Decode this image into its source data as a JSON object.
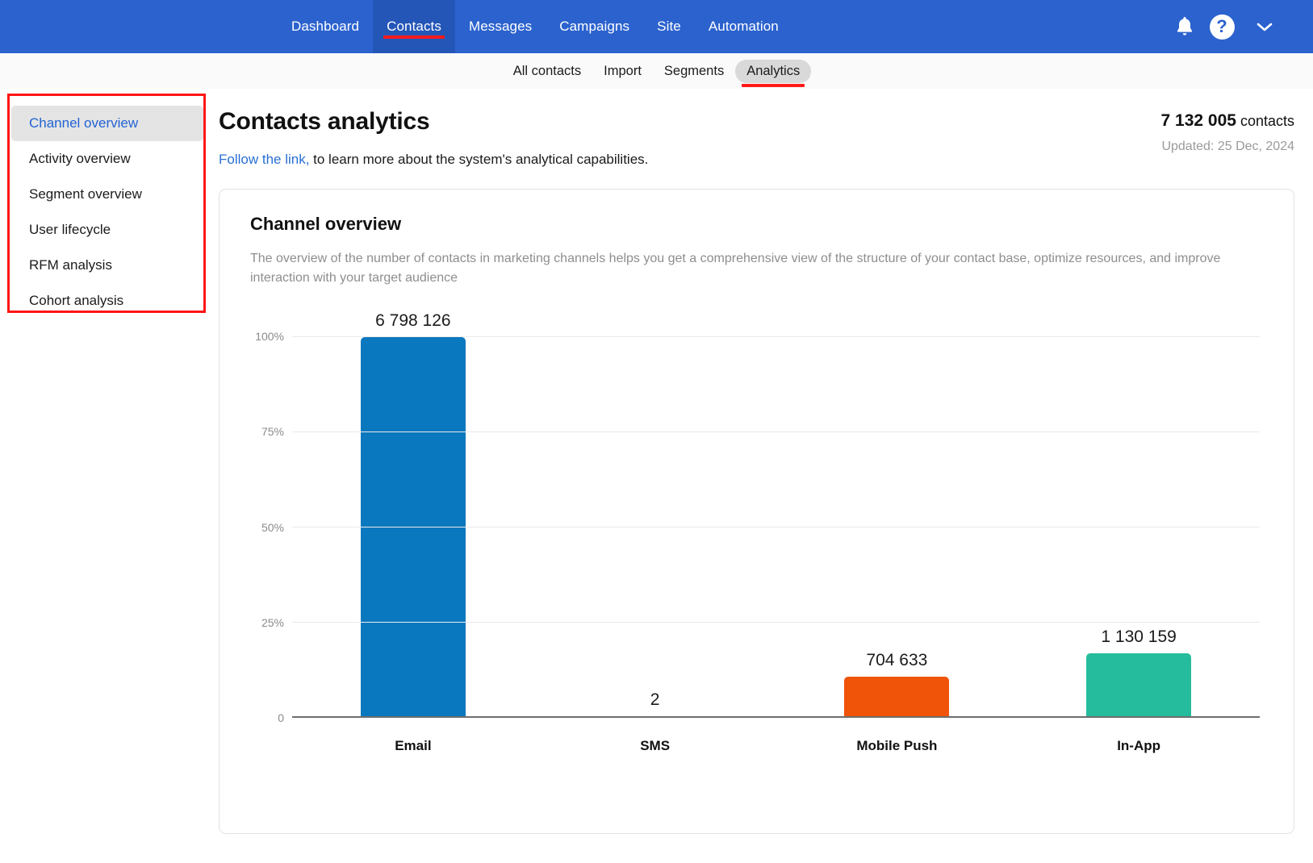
{
  "topnav": {
    "items": [
      {
        "label": "Dashboard",
        "active": false,
        "annotated": false
      },
      {
        "label": "Contacts",
        "active": true,
        "annotated": true
      },
      {
        "label": "Messages",
        "active": false,
        "annotated": false
      },
      {
        "label": "Campaigns",
        "active": false,
        "annotated": false
      },
      {
        "label": "Site",
        "active": false,
        "annotated": false
      },
      {
        "label": "Automation",
        "active": false,
        "annotated": false
      }
    ],
    "bell_icon": "bell-icon",
    "help_label": "?",
    "chevron_label": "⌄",
    "bg_color": "#2b62ce",
    "active_bg_color": "#2456b8"
  },
  "subnav": {
    "items": [
      {
        "label": "All contacts",
        "active": false,
        "annotated": false
      },
      {
        "label": "Import",
        "active": false,
        "annotated": false
      },
      {
        "label": "Segments",
        "active": false,
        "annotated": false
      },
      {
        "label": "Analytics",
        "active": true,
        "annotated": true
      }
    ]
  },
  "sidebar": {
    "items": [
      {
        "label": "Channel overview",
        "active": true
      },
      {
        "label": "Activity overview",
        "active": false
      },
      {
        "label": "Segment overview",
        "active": false
      },
      {
        "label": "User lifecycle",
        "active": false
      },
      {
        "label": "RFM analysis",
        "active": false
      },
      {
        "label": "Cohort analysis",
        "active": false
      }
    ],
    "annotation_color": "#ff1515"
  },
  "main": {
    "title": "Contacts analytics",
    "subtitle_link": "Follow the link,",
    "subtitle_rest": " to learn more about the system's analytical capabilities.",
    "contacts_count": "7 132 005",
    "contacts_word": "contacts",
    "updated": "Updated: 25 Dec, 2024"
  },
  "card": {
    "title": "Channel overview",
    "description": "The overview of the number of contacts in marketing channels helps you get a comprehensive view of the structure of your contact base, optimize resources, and improve interaction with your target audience"
  },
  "chart_data": {
    "type": "bar",
    "title": "Channel overview",
    "xlabel": "",
    "ylabel": "",
    "categories": [
      "Email",
      "SMS",
      "Mobile Push",
      "In-App"
    ],
    "values": [
      6798126,
      2,
      704633,
      1130159
    ],
    "value_labels": [
      "6 798 126",
      "2",
      "704 633",
      "1 130 159"
    ],
    "colors": [
      "#0a78bf",
      "#0a78bf",
      "#ef5409",
      "#25bc9d"
    ],
    "percent_of_max": [
      100,
      0.0,
      10.36,
      16.62
    ],
    "ytick_labels": [
      "100%",
      "75%",
      "50%",
      "25%",
      "0"
    ],
    "ytick_percents": [
      100,
      75,
      50,
      25,
      0
    ],
    "ylim": [
      0,
      100
    ],
    "grid": true,
    "legend": "none"
  }
}
